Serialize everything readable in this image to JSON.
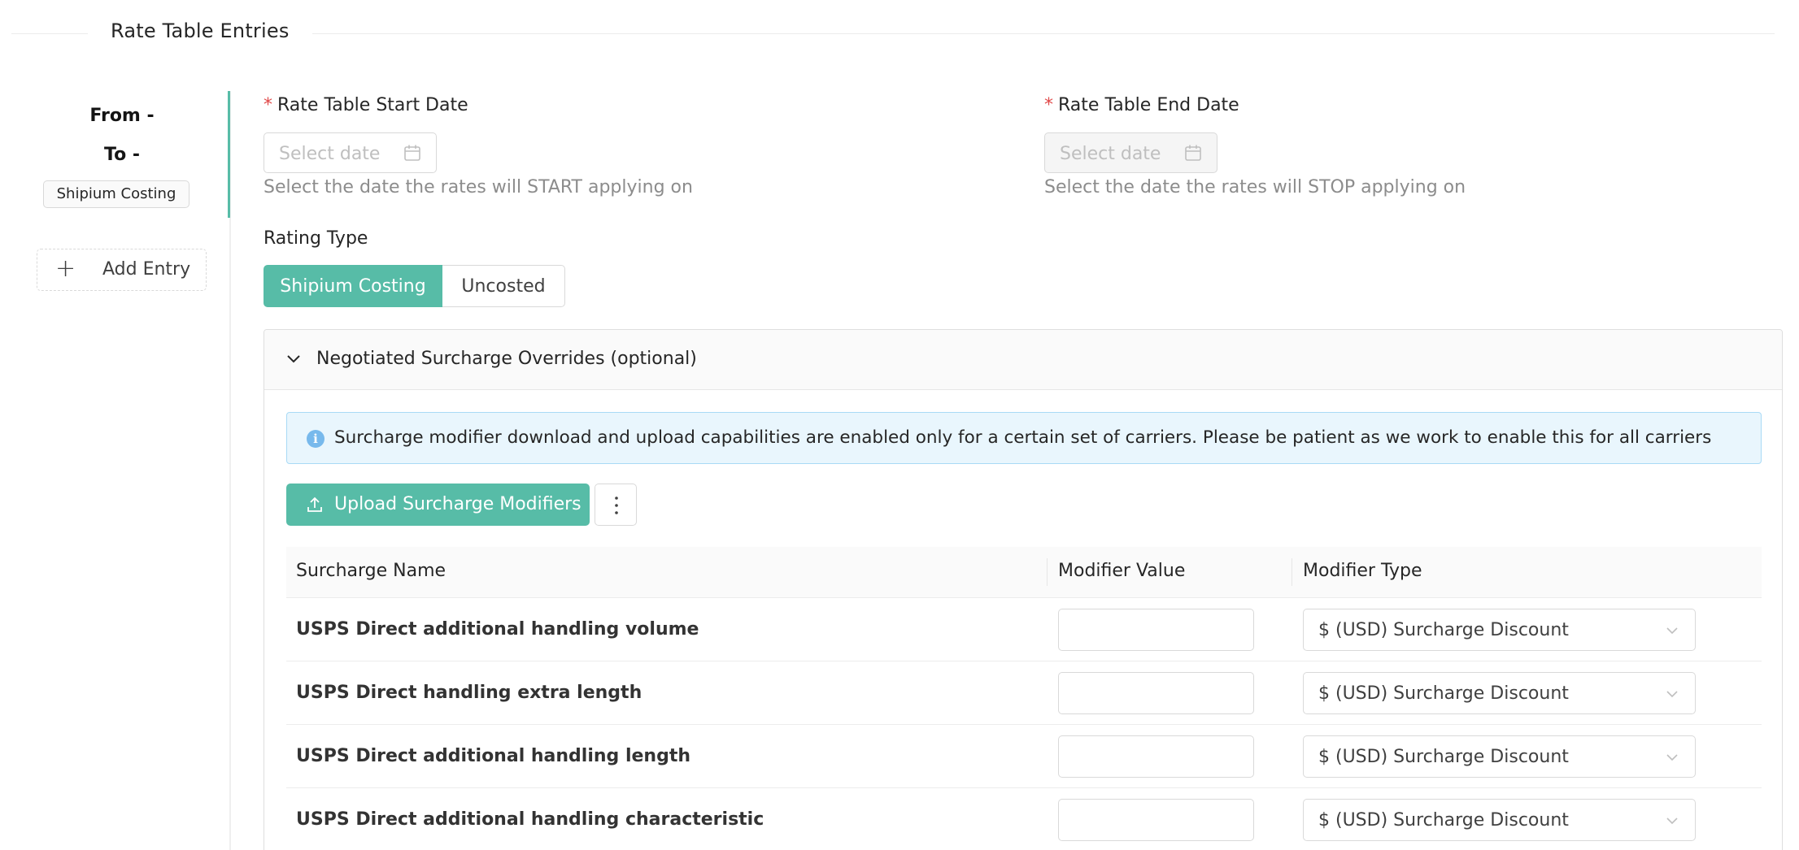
{
  "section": {
    "title": "Rate Table Entries"
  },
  "entries": {
    "items": [
      {
        "from_label": "From -",
        "to_label": "To -",
        "tag": "Shipium Costing"
      }
    ],
    "add_label": "Add Entry"
  },
  "start_date": {
    "required_mark": "*",
    "label": "Rate Table Start Date",
    "placeholder": "Select date",
    "help": "Select the date the rates will START applying on"
  },
  "end_date": {
    "required_mark": "*",
    "label": "Rate Table End Date",
    "placeholder": "Select date",
    "help": "Select the date the rates will STOP applying on"
  },
  "rating_type": {
    "label": "Rating Type",
    "options": [
      "Shipium Costing",
      "Uncosted"
    ],
    "selected": "Shipium Costing"
  },
  "surcharge_panel": {
    "title": "Negotiated Surcharge Overrides (optional)",
    "alert": "Surcharge modifier download and upload capabilities are enabled only for a certain set of carriers. Please be patient as we work to enable this for all carriers",
    "upload_label": "Upload Surcharge Modifiers",
    "columns": [
      "Surcharge Name",
      "Modifier Value",
      "Modifier Type"
    ],
    "rows": [
      {
        "name": "USPS Direct additional handling volume",
        "value": "",
        "type": "$ (USD) Surcharge Discount"
      },
      {
        "name": "USPS Direct handling extra length",
        "value": "",
        "type": "$ (USD) Surcharge Discount"
      },
      {
        "name": "USPS Direct additional handling length",
        "value": "",
        "type": "$ (USD) Surcharge Discount"
      },
      {
        "name": "USPS Direct additional handling characteristic",
        "value": "",
        "type": "$ (USD) Surcharge Discount"
      }
    ]
  },
  "colors": {
    "accent": "#57bca7",
    "required": "#e04848",
    "info_bg": "#e9f6fd",
    "info_border": "#a9daf6"
  },
  "icons": [
    "plus-icon",
    "calendar-icon",
    "chevron-down-icon",
    "info-icon",
    "upload-icon",
    "more-vertical-icon"
  ]
}
